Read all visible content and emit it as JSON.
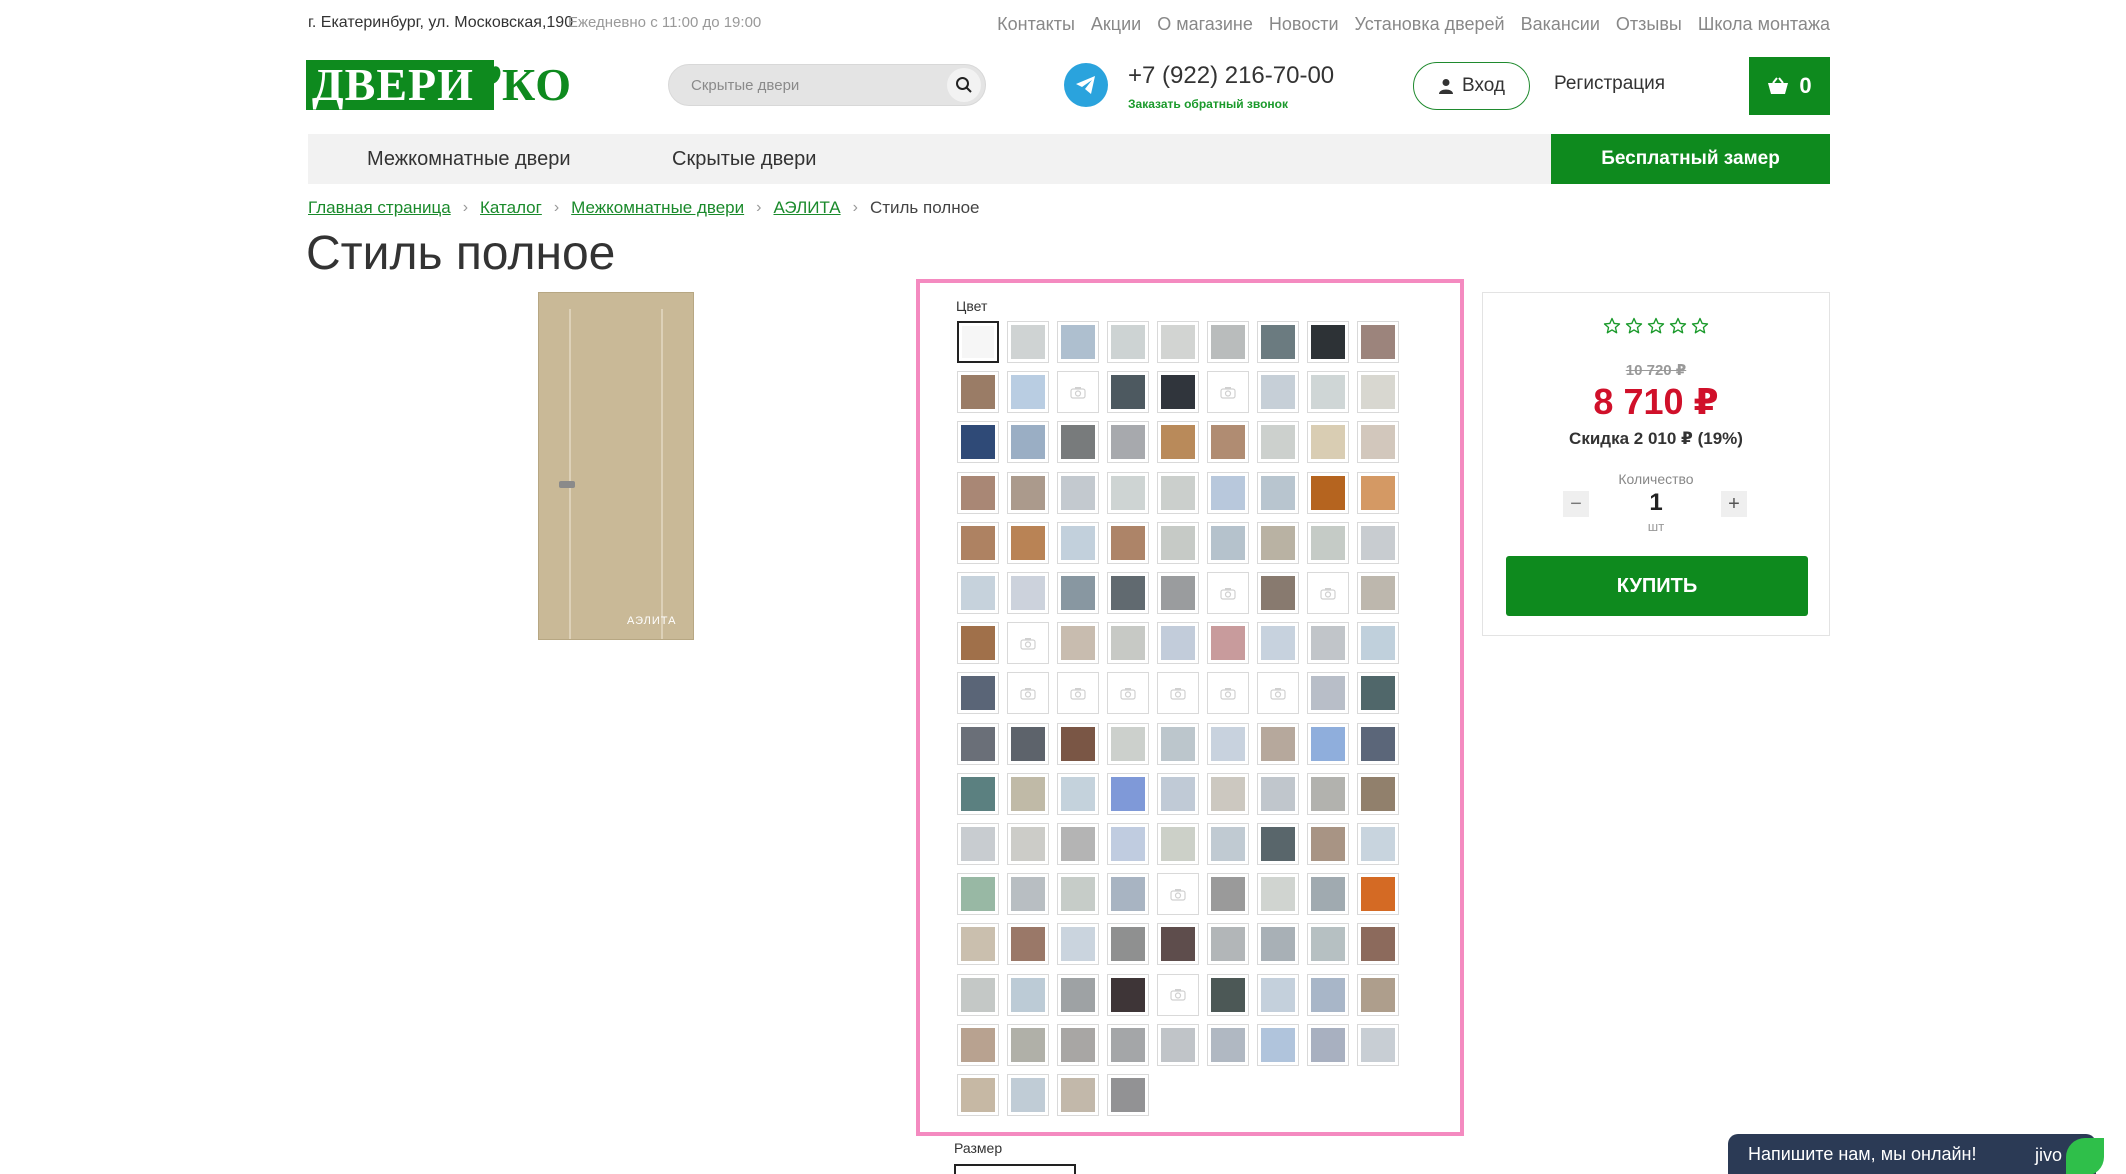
{
  "topbar": {
    "address": "г. Екатеринбург, ул. Московская,190",
    "hours": "Ежедневно с 11:00 до 19:00",
    "links": [
      "Контакты",
      "Акции",
      "О магазине",
      "Новости",
      "Установка дверей",
      "Вакансии",
      "Отзывы",
      "Школа монтажа"
    ]
  },
  "logo": {
    "part1": "ДВЕРИ",
    "part2": "КО"
  },
  "search": {
    "placeholder": "Скрытые двери"
  },
  "contact": {
    "phone": "+7 (922) 216-70-00",
    "callback": "Заказать обратный звонок"
  },
  "account": {
    "login": "Вход",
    "register": "Регистрация",
    "cart_count": "0"
  },
  "nav": {
    "item1": "Межкомнатные двери",
    "item2": "Скрытые двери",
    "cta": "Бесплатный замер"
  },
  "breadcrumb": [
    "Главная страница",
    "Каталог",
    "Межкомнатные двери",
    "АЭЛИТА",
    "Стиль полное"
  ],
  "product": {
    "title": "Стиль полное",
    "brand": "АЭЛИТА"
  },
  "palette": {
    "label": "Цвет",
    "size_label": "Размер",
    "swatches": [
      "#f6f6f6",
      "#cfd3d3",
      "#aebfcf",
      "#cdd3d3",
      "#d2d4d2",
      "#b9bcbc",
      "#6b7b80",
      "#2d3236",
      "#9c847c",
      "#9a7c66",
      "#b9cde2",
      "empty",
      "#4d5960",
      "#30353c",
      "empty",
      "#c6cfd7",
      "#cfd6d6",
      "#d8d7d0",
      "#2f4a77",
      "#9aaec4",
      "#787b7c",
      "#a7a9ad",
      "#b98a5a",
      "#b08c72",
      "#ccd0cd",
      "#d9cdb3",
      "#d2c7bc",
      "#a98775",
      "#ab9a8c",
      "#c3c9cf",
      "#ced4d3",
      "#cbcfcc",
      "#b8c8dc",
      "#b8c5cf",
      "#b5641f",
      "#d49964",
      "#ae8262",
      "#b98355",
      "#c2d0dc",
      "#ad8468",
      "#c6cac6",
      "#b5c2cc",
      "#b9b2a3",
      "#c5cbc6",
      "#c8ccd0",
      "#c6d2dc",
      "#ccd2dc",
      "#8897a1",
      "#616a70",
      "#9a9c9e",
      "empty",
      "#887a6f",
      "empty",
      "#bdb7ad",
      "#a0704a",
      "empty",
      "#c8bcaf",
      "#c7c9c5",
      "#c2ccda",
      "#c89b9c",
      "#c7d2de",
      "#c1c5c9",
      "#c0d0dc",
      "#5a6577",
      "empty",
      "empty",
      "empty",
      "empty",
      "empty",
      "empty",
      "#b8bec8",
      "#50676a",
      "#6a6f78",
      "#5d636b",
      "#7a5645",
      "#ccd0cc",
      "#bcc6cc",
      "#c8d2de",
      "#b6a89c",
      "#8faedc",
      "#5b6679",
      "#5b8080",
      "#c0baa7",
      "#c4d2dc",
      "#7f99d8",
      "#c0cad6",
      "#ccc8c0",
      "#c0c6cc",
      "#b2b2ae",
      "#91806c",
      "#c8ccd0",
      "#ccccc8",
      "#b4b4b4",
      "#c0cce0",
      "#ccd0c8",
      "#c0cad2",
      "#59666b",
      "#a89484",
      "#c8d4de",
      "#98b8a4",
      "#b8bec2",
      "#c6ccc8",
      "#a8b4c2",
      "empty",
      "#9a9a9a",
      "#d0d4d0",
      "#a0aab0",
      "#d46a24",
      "#cabfae",
      "#9a7868",
      "#cad4de",
      "#8f9090",
      "#5e4d4c",
      "#b2b6b8",
      "#a8b0b6",
      "#b6c0c2",
      "#8c6a5c",
      "#c4c8c6",
      "#bccbd6",
      "#9ea2a4",
      "#3e3537",
      "empty",
      "#4c5856",
      "#c4d0dc",
      "#a8b6c8",
      "#ae9e8c",
      "#b8a290",
      "#b0b0a8",
      "#a8a6a4",
      "#a4a6a8",
      "#c0c4c8",
      "#b0b8c2",
      "#b0c4dc",
      "#a8b0c0",
      "#c8ced4",
      "#c6b8a4",
      "#c0ccd6",
      "#c2b8aa",
      "#929294"
    ]
  },
  "pricing": {
    "old_price": "10 720 ₽",
    "price": "8 710 ₽",
    "discount": "Скидка 2 010 ₽ (19%)",
    "qty_label": "Количество",
    "qty": "1",
    "qty_unit": "шт",
    "buy": "КУПИТЬ",
    "rating_stars": 5
  },
  "chat": {
    "text": "Напишите нам, мы онлайн!",
    "brand": "jivo"
  },
  "colors": {
    "brand_green": "#0e8a1e",
    "price_red": "#d0102a",
    "highlight_pink": "#f48ac0"
  }
}
